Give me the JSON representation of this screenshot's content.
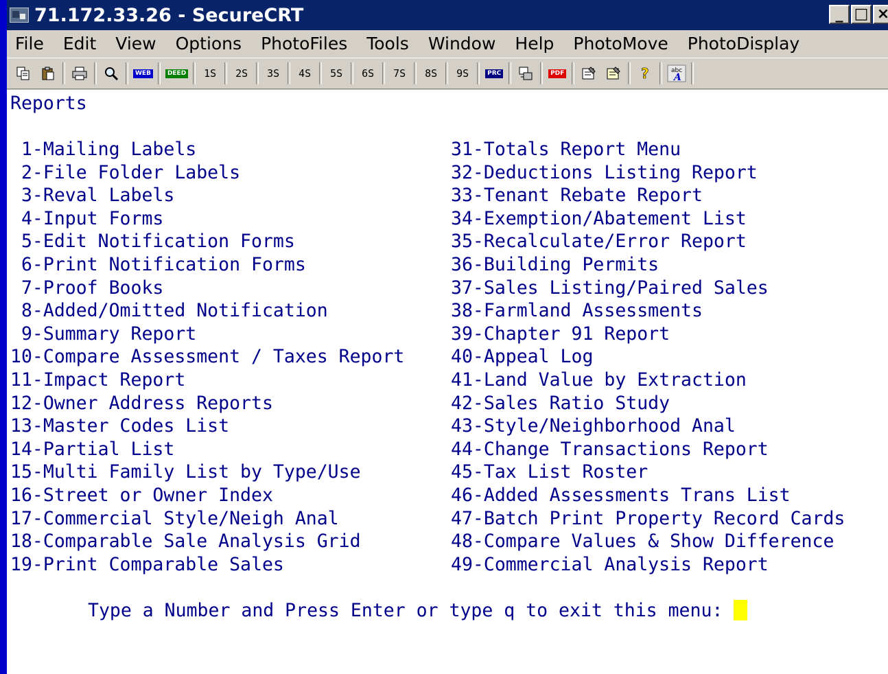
{
  "window": {
    "title": "71.172.33.26 - SecureCRT",
    "controls": [
      "_",
      "□",
      "×"
    ]
  },
  "menu": [
    "File",
    "Edit",
    "View",
    "Options",
    "PhotoFiles",
    "Tools",
    "Window",
    "Help",
    "PhotoMove",
    "PhotoDisplay"
  ],
  "toolbar": {
    "icons": [
      "copy-icon",
      "paste-icon",
      "print-icon",
      "find-icon",
      "web-icon",
      "deed-icon",
      "prc-icon",
      "transfer-icon",
      "pdf-icon",
      "properties-icon",
      "global-properties-icon",
      "help-icon",
      "keymap-icon"
    ],
    "web_label": "WEB",
    "deed_label": "DEED",
    "prc_label": "PRC",
    "pdf_label": "PDF",
    "keymap_label": "abc",
    "s_buttons": [
      "1S",
      "2S",
      "3S",
      "4S",
      "5S",
      "6S",
      "7S",
      "8S",
      "9S"
    ]
  },
  "terminal": {
    "heading": "Reports",
    "left_items": [
      " 1-Mailing Labels",
      " 2-File Folder Labels",
      " 3-Reval Labels",
      " 4-Input Forms",
      " 5-Edit Notification Forms",
      " 6-Print Notification Forms",
      " 7-Proof Books",
      " 8-Added/Omitted Notification",
      " 9-Summary Report",
      "10-Compare Assessment / Taxes Report",
      "11-Impact Report",
      "12-Owner Address Reports",
      "13-Master Codes List",
      "14-Partial List",
      "15-Multi Family List by Type/Use",
      "16-Street or Owner Index",
      "17-Commercial Style/Neigh Anal",
      "18-Comparable Sale Analysis Grid",
      "19-Print Comparable Sales"
    ],
    "right_items": [
      "31-Totals Report Menu",
      "32-Deductions Listing Report",
      "33-Tenant Rebate Report",
      "34-Exemption/Abatement List",
      "35-Recalculate/Error Report",
      "36-Building Permits",
      "37-Sales Listing/Paired Sales",
      "38-Farmland Assessments",
      "39-Chapter 91 Report",
      "40-Appeal Log",
      "41-Land Value by Extraction",
      "42-Sales Ratio Study",
      "43-Style/Neighborhood Anal",
      "44-Change Transactions Report",
      "45-Tax List Roster",
      "46-Added Assessments Trans List",
      "47-Batch Print Property Record Cards",
      "48-Compare Values & Show Difference",
      "49-Commercial Analysis Report"
    ],
    "prompt": "Type a Number and Press Enter or type q to exit this menu: "
  },
  "colors": {
    "desktop": "#0000cc",
    "titlebar": "#0a246a",
    "terminal_text": "#00008b",
    "terminal_bg": "#ffffff",
    "cursor": "#ffff00"
  }
}
